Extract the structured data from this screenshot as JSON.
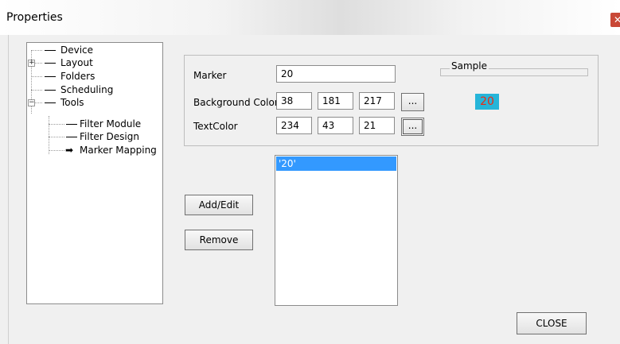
{
  "window": {
    "title": "Properties",
    "close_glyph": "✕"
  },
  "tree": {
    "items": [
      {
        "label": "Device",
        "has_expander": false
      },
      {
        "label": "Layout",
        "has_expander": true,
        "expander_glyph": "+"
      },
      {
        "label": "Folders",
        "has_expander": false
      },
      {
        "label": "Scheduling",
        "has_expander": false
      },
      {
        "label": "Tools",
        "has_expander": true,
        "expander_glyph": "−"
      },
      {
        "label": "Filter Module",
        "has_expander": false
      },
      {
        "label": "Filter Design",
        "has_expander": false
      },
      {
        "label": "Marker Mapping",
        "has_expander": false,
        "selected_icon": "arrow-right-icon",
        "glyph": "➡"
      }
    ]
  },
  "marker": {
    "label": "Marker",
    "value": "20"
  },
  "background_color": {
    "label": "Background Color",
    "r": "38",
    "g": "181",
    "b": "217",
    "browse_label": "...",
    "hex": "#26b5d9"
  },
  "text_color": {
    "label": "TextColor",
    "r": "234",
    "g": "43",
    "b": "21",
    "browse_label": "...",
    "hex": "#ea2b15"
  },
  "sample": {
    "label": "Sample",
    "text": "20"
  },
  "buttons": {
    "add_edit": "Add/Edit",
    "remove": "Remove",
    "close": "CLOSE"
  },
  "markers_list": {
    "items": [
      "'20'"
    ],
    "selected_index": 0,
    "selection_color": "#3399ff"
  }
}
